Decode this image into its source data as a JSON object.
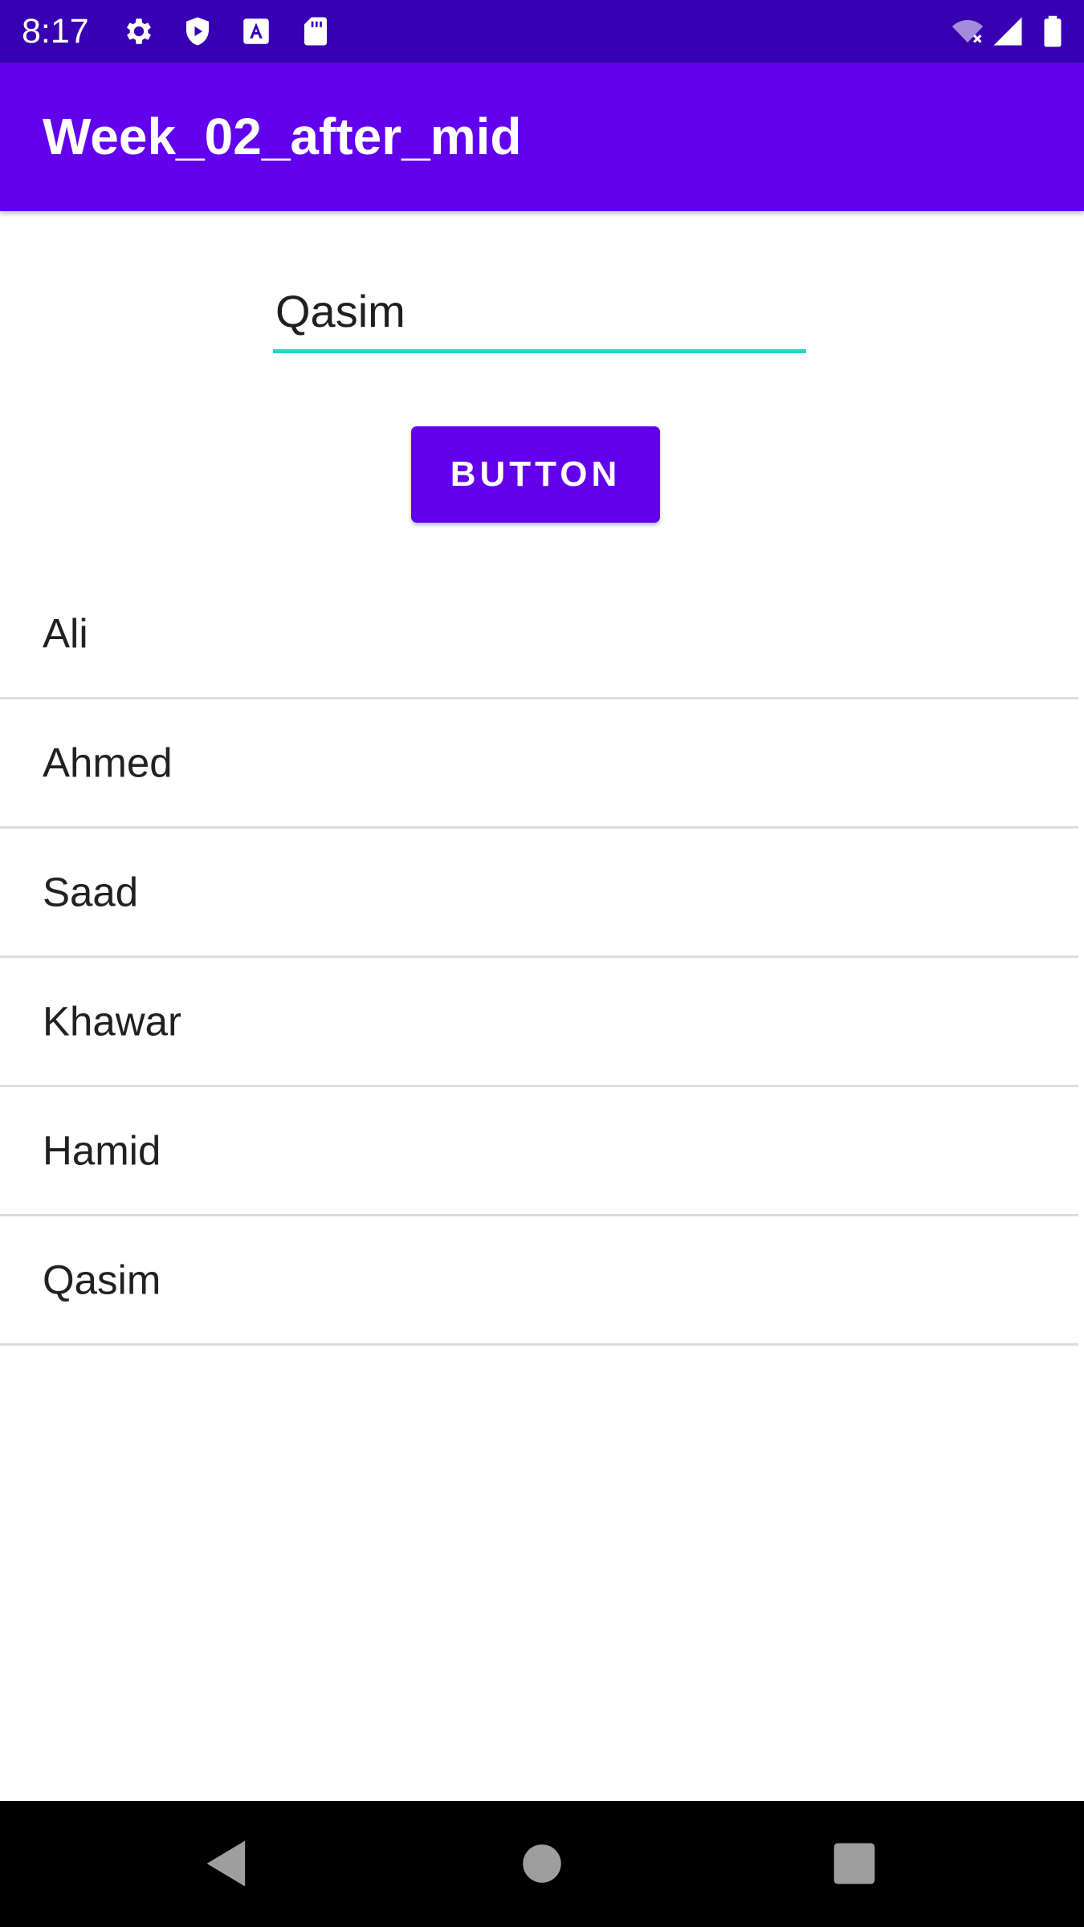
{
  "status_bar": {
    "time": "8:17",
    "left_icons": [
      "gear-icon",
      "shield-play-icon",
      "a-box-icon",
      "sd-card-icon"
    ],
    "right_icons": [
      "wifi-off-icon",
      "signal-icon",
      "battery-icon"
    ],
    "background_color": "#3700b3"
  },
  "app_bar": {
    "title": "Week_02_after_mid",
    "background_color": "#6200ee"
  },
  "text_field": {
    "value": "Qasim",
    "underline_color": "#26d3c4"
  },
  "button": {
    "label": "BUTTON",
    "background_color": "#6200ee"
  },
  "list": {
    "items": [
      "Ali",
      "Ahmed",
      "Saad",
      "Khawar",
      "Hamid",
      "Qasim"
    ]
  },
  "nav_bar": {
    "buttons": [
      "back-icon",
      "home-icon",
      "recents-icon"
    ]
  }
}
